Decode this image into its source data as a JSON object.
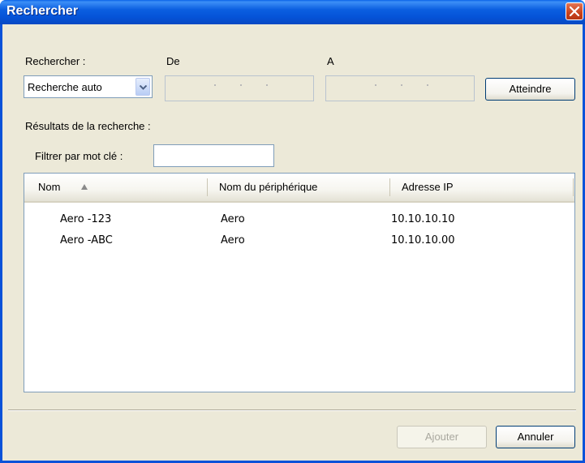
{
  "dialog": {
    "title": "Rechercher"
  },
  "search": {
    "mode_label": "Rechercher :",
    "mode_value": "Recherche auto",
    "from_label": "De",
    "to_label": "A",
    "go_button": "Atteindre"
  },
  "results": {
    "heading": "Résultats de la recherche :",
    "filter_label": "Filtrer par mot clé :",
    "filter_value": "",
    "columns": [
      "Nom",
      "Nom du périphérique",
      "Adresse IP"
    ],
    "sort_column": "Nom",
    "sort_direction": "ascending",
    "rows": [
      {
        "name": "Aero -123",
        "device": "Aero",
        "ip": "10.10.10.10"
      },
      {
        "name": "Aero -ABC",
        "device": "Aero",
        "ip": "10.10.10.00"
      }
    ]
  },
  "footer": {
    "add_button": "Ajouter",
    "add_enabled": false,
    "cancel_button": "Annuler"
  },
  "colors": {
    "titlebar": "#0553d8",
    "window_bg": "#ece9d8",
    "close_button": "#c9421c"
  }
}
